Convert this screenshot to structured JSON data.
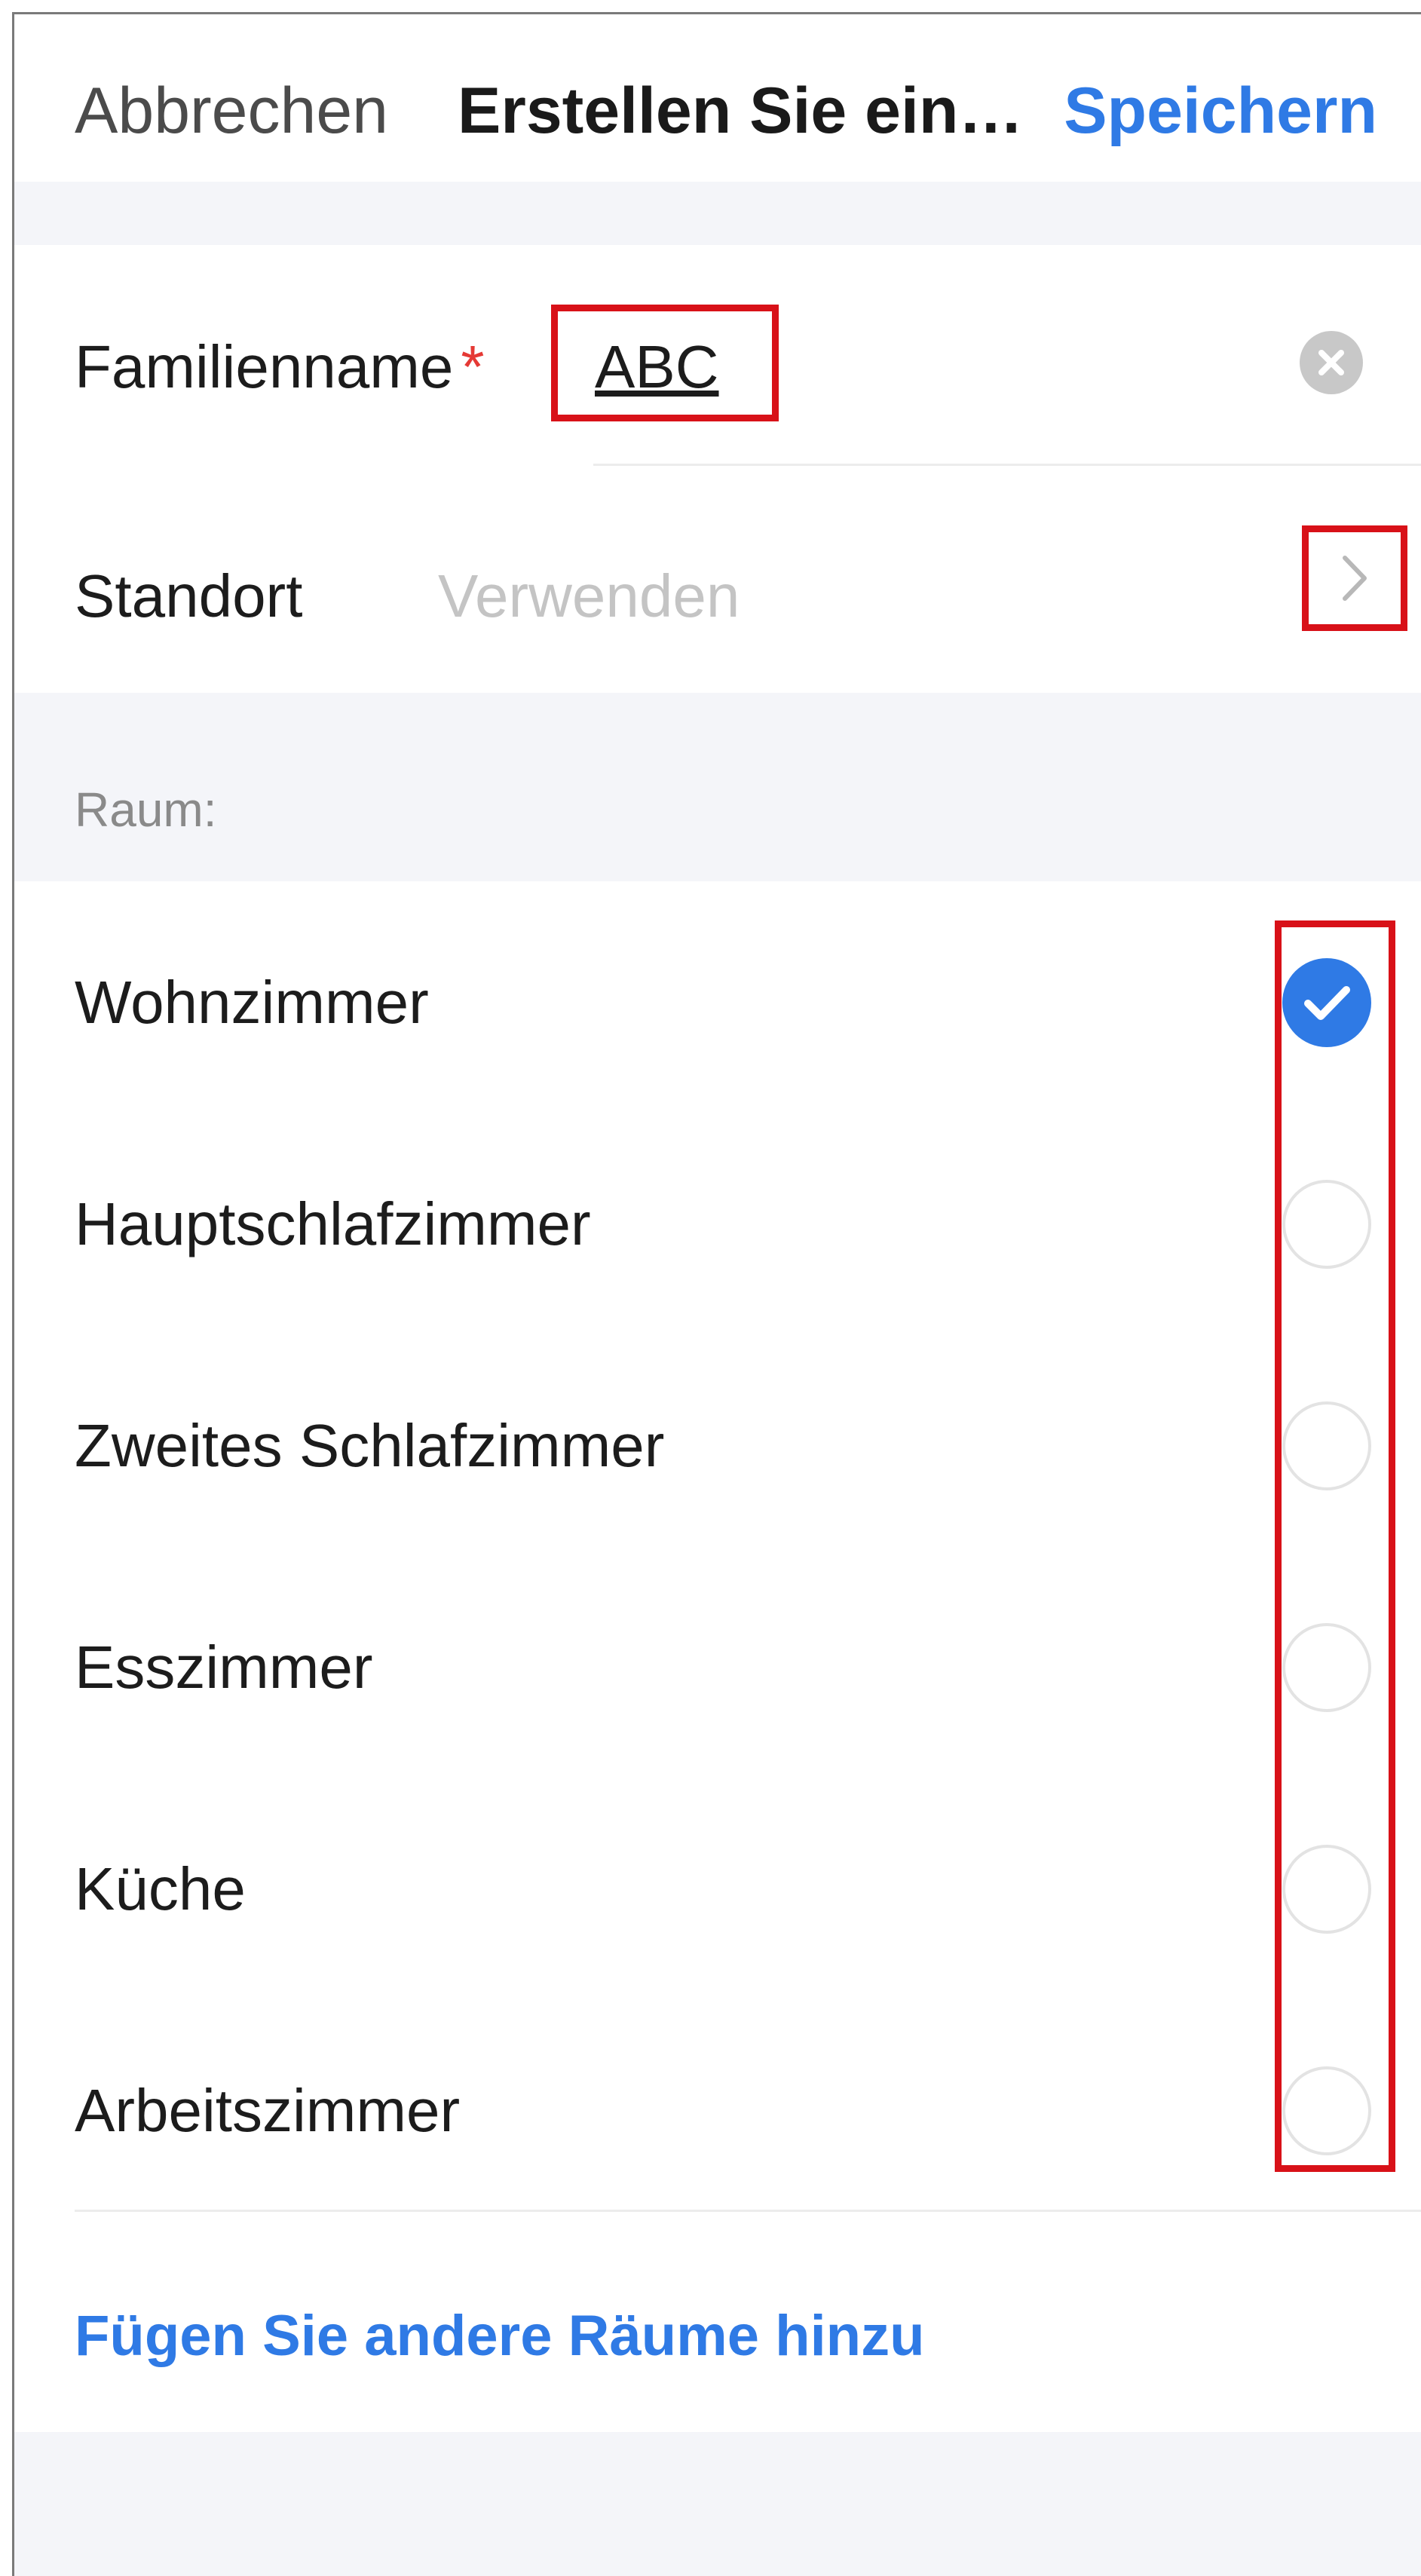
{
  "header": {
    "cancel_label": "Abbrechen",
    "title": "Erstellen Sie ein…",
    "save_label": "Speichern"
  },
  "family": {
    "name_label": "Familienname",
    "required_mark": "*",
    "name_value": "ABC"
  },
  "location": {
    "label": "Standort",
    "placeholder": "Verwenden"
  },
  "rooms": {
    "section_label": "Raum:",
    "items": [
      {
        "label": "Wohnzimmer",
        "checked": true
      },
      {
        "label": "Hauptschlafzimmer",
        "checked": false
      },
      {
        "label": "Zweites Schlafzimmer",
        "checked": false
      },
      {
        "label": "Esszimmer",
        "checked": false
      },
      {
        "label": "Küche",
        "checked": false
      },
      {
        "label": "Arbeitszimmer",
        "checked": false
      }
    ],
    "add_label": "Fügen Sie andere Räume hinzu"
  },
  "colors": {
    "accent": "#2f7ae5",
    "highlight": "#d81118",
    "required": "#e53935",
    "background_band": "#f4f5f9"
  }
}
